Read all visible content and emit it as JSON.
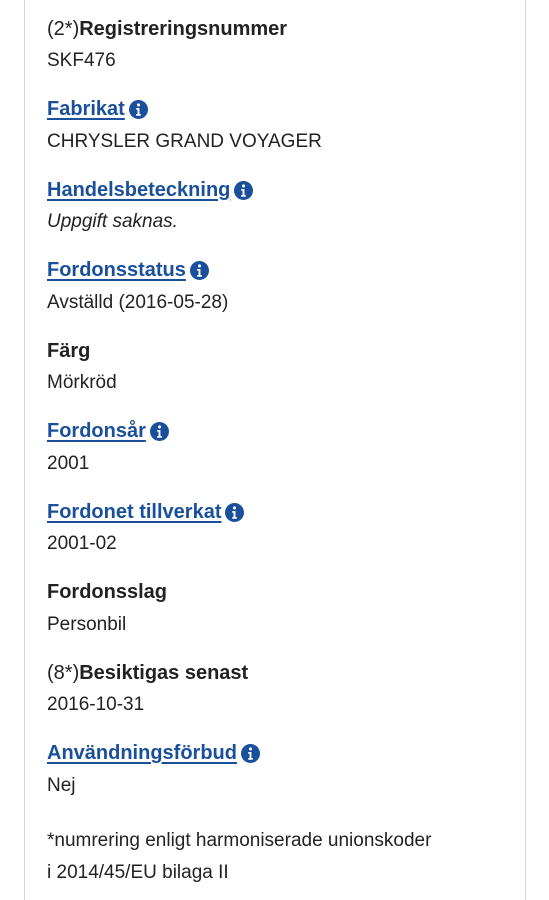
{
  "fields": [
    {
      "prefix": "(2*)",
      "label": "Registreringsnummer",
      "value": "SKF476"
    },
    {
      "label": "Fabrikat",
      "value": "CHRYSLER GRAND VOYAGER"
    },
    {
      "label": "Handelsbeteckning",
      "value": "Uppgift saknas."
    },
    {
      "label": "Fordonsstatus",
      "value": "Avställd (2016-05-28)"
    },
    {
      "label": "Färg",
      "value": "Mörkröd"
    },
    {
      "label": "Fordonsår",
      "value": "2001"
    },
    {
      "label": "Fordonet tillverkat",
      "value": "2001-02"
    },
    {
      "label": "Fordonsslag",
      "value": "Personbil"
    },
    {
      "prefix": "(8*)",
      "label": "Besiktigas senast",
      "value": "2016-10-31"
    },
    {
      "label": "Användningsförbud",
      "value": "Nej"
    }
  ],
  "footnote": {
    "line1": "*numrering enligt harmoniserade unionskoder",
    "line2": "i 2014/45/EU bilaga II"
  },
  "icons": {
    "info": "info-circle-icon"
  },
  "colors": {
    "link": "#1a4f9c",
    "text": "#222222",
    "border": "#d9d9d9"
  }
}
